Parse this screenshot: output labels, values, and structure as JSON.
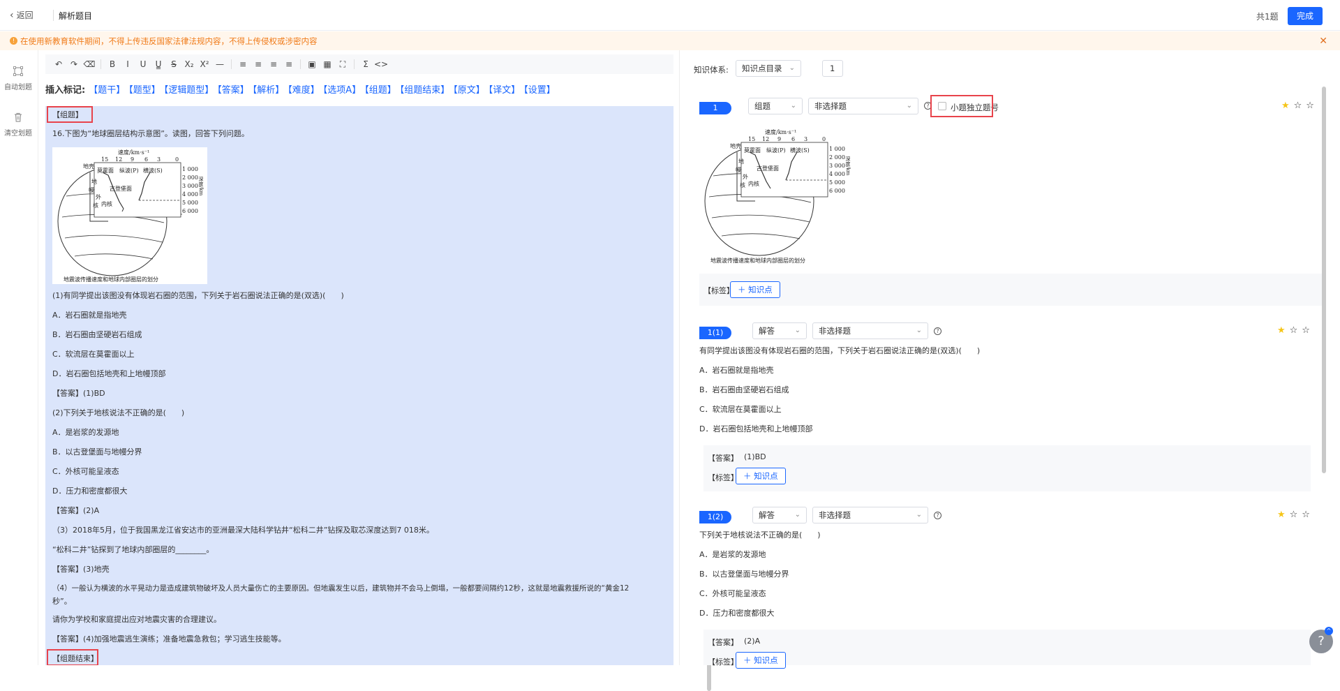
{
  "header": {
    "back_icon": "chevron-left-icon",
    "back_label": "返回",
    "title": "解析题目",
    "count": "共1题",
    "done_label": "完成"
  },
  "notice": {
    "icon": "warning-icon",
    "text": "在使用新教育软件期间，不得上传违反国家法律法规内容，不得上传侵权或涉密内容",
    "close": "✕"
  },
  "sidebar": {
    "auto_split": "自动划题",
    "clear_split": "清空划题"
  },
  "toolbar": {
    "icons": [
      "undo-icon",
      "redo-icon",
      "eraser-icon",
      "bold-icon",
      "italic-icon",
      "underline-icon",
      "underline-double-icon",
      "strikethrough-icon",
      "subscript-icon",
      "superscript-icon",
      "horizontal-rule-icon",
      "align-left-icon",
      "align-center-icon",
      "align-right-icon",
      "align-justify-icon",
      "image-icon",
      "table-icon",
      "fullscreen-icon",
      "formula-icon",
      "code-icon"
    ],
    "glyphs": [
      "↶",
      "↷",
      "⌫",
      "B",
      "I",
      "U",
      "U̳",
      "S̶",
      "X₂",
      "X²",
      "—",
      "≡",
      "≡",
      "≡",
      "≡",
      "▣",
      "▦",
      "⛶",
      "Σ",
      "<>"
    ]
  },
  "marks": {
    "label": "插入标记:",
    "items": [
      "【题干】",
      "【题型】",
      "【逻辑题型】",
      "【答案】",
      "【解析】",
      "【难度】",
      "【选项A】",
      "【组题】",
      "【组题结束】",
      "【原文】",
      "【译文】",
      "【设置】"
    ]
  },
  "content": {
    "lines": [
      "【组题】",
      "16.下图为“地球圈层结构示意图”。读图，回答下列问题。",
      "(1)有同学提出该图没有体现岩石圈的范围，下列关于岩石圈说法正确的是(双选)(　　)",
      "A．岩石圈就是指地壳",
      "B．岩石圈由坚硬岩石组成",
      "C．软流层在莫霍面以上",
      "D．岩石圈包括地壳和上地幔顶部",
      "【答案】(1)BD",
      "(2)下列关于地核说法不正确的是(　　)",
      "A．是岩浆的发源地",
      "B．以古登堡面与地幔分界",
      "C．外核可能呈液态",
      "D．压力和密度都很大",
      "【答案】(2)A",
      "（3）2018年5月，位于我国黑龙江省安达市的亚洲最深大陆科学钻井“松科二井”钻探及取芯深度达到7 018米。",
      "“松科二井”钻探到了地球内部圈层的________。",
      "【答案】(3)地壳",
      "（4）一般认为横波的水平晃动力是造成建筑物破坏及人员大量伤亡的主要原因。但地震发生以后，建筑物并不会马上倒塌，一般都要间隔约12秒，这就是地震救援所说的“黄金12",
      "秒”。",
      "请你为学校和家庭提出应对地震灾害的合理建议。",
      "【答案】(4)加强地震逃生演练；准备地震急救包；学习逃生技能等。",
      "【组题结束】"
    ],
    "figure": {
      "speed_label": "速度/km·s⁻¹",
      "speed_ticks": [
        "15",
        "12",
        "9",
        "6",
        "3",
        "0"
      ],
      "depth_label": "深度/km",
      "depth_ticks": [
        "1 000",
        "2 000",
        "3 000",
        "4 000",
        "5 000",
        "6 000"
      ],
      "crust": "地壳",
      "moho": "莫霍面",
      "p_wave": "纵波(P)",
      "s_wave": "横波(S)",
      "mantle_1": "地",
      "mantle_2": "幔",
      "gutenberg": "古登堡面",
      "outer_1": "外",
      "outer_2": "核",
      "inner": "内核",
      "caption": "地震波传播速度和地球内部圈层的划分"
    }
  },
  "right": {
    "ks_label": "知识体系:",
    "ks_select": "知识点目录",
    "ks_num": "1",
    "card1": {
      "num": "1",
      "type": "组题",
      "subtype": "非选择题",
      "checkbox_label": "小题独立题号",
      "tag_label": "【标签】",
      "kbtn": "＋ 知识点"
    },
    "card2": {
      "num": "1(1)",
      "type": "解答",
      "subtype": "非选择题",
      "stem": "有同学提出该图没有体现岩石圈的范围，下列关于岩石圈说法正确的是(双选)(　　)",
      "options": [
        "A．岩石圈就是指地壳",
        "B．岩石圈由坚硬岩石组成",
        "C．软流层在莫霍面以上",
        "D．岩石圈包括地壳和上地幔顶部"
      ],
      "answer_label": "【答案】",
      "answer": "(1)BD",
      "tag_label": "【标签】",
      "kbtn": "＋ 知识点"
    },
    "card3": {
      "num": "1(2)",
      "type": "解答",
      "subtype": "非选择题",
      "stem": "下列关于地核说法不正确的是(　　)",
      "options": [
        "A．是岩浆的发源地",
        "B．以古登堡面与地幔分界",
        "C．外核可能呈液态",
        "D．压力和密度都很大"
      ],
      "answer_label": "【答案】",
      "answer": "(2)A",
      "tag_label": "【标签】",
      "kbtn": "＋ 知识点"
    },
    "stars": {
      "filled": "★",
      "empty": "☆☆"
    },
    "help_fab": "?",
    "fab_badge": "^"
  },
  "colors": {
    "accent": "#1a66ff",
    "notice_bg": "#fff6ec",
    "notice_text": "#f07a17",
    "content_bg": "#dbe5fb",
    "red_box": "#e8434b",
    "star": "#f5c518"
  }
}
